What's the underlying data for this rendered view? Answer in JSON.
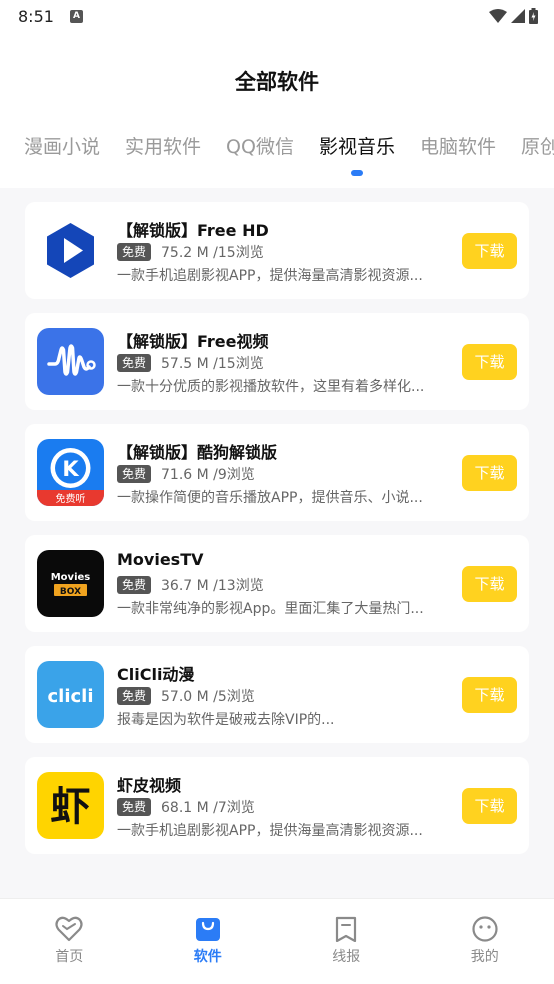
{
  "status_bar": {
    "time": "8:51",
    "notification_letter": "A"
  },
  "header": {
    "title": "全部软件"
  },
  "tabs": [
    {
      "label": "漫画小说"
    },
    {
      "label": "实用软件"
    },
    {
      "label": "QQ微信"
    },
    {
      "label": "影视音乐",
      "active": true
    },
    {
      "label": "电脑软件"
    },
    {
      "label": "原创"
    }
  ],
  "apps": [
    {
      "name": "【解锁版】Free HD",
      "badge": "免费",
      "meta": "75.2 M /15浏览",
      "desc": "一款手机追剧影视APP，提供海量高清影视资源...",
      "button": "下载",
      "icon": "play-triangle-icon"
    },
    {
      "name": "【解锁版】Free视频",
      "badge": "免费",
      "meta": "57.5 M /15浏览",
      "desc": "一款十分优质的影视播放软件，这里有着多样化...",
      "button": "下载",
      "icon": "waveform-icon"
    },
    {
      "name": "【解锁版】酷狗解锁版",
      "badge": "免费",
      "meta": "71.6 M /9浏览",
      "desc": "一款操作简便的音乐播放APP，提供音乐、小说...",
      "button": "下载",
      "icon": "kugou-icon",
      "icon_text": "免费听",
      "icon_letter": "K"
    },
    {
      "name": "MoviesTV",
      "badge": "免费",
      "meta": "36.7 M /13浏览",
      "desc": "一款非常纯净的影视App。里面汇集了大量热门...",
      "button": "下载",
      "icon": "movies-box-icon",
      "icon_text_top": "Movies",
      "icon_text_bottom": "BOX"
    },
    {
      "name": "CliCli动漫",
      "badge": "免费",
      "meta": "57.0 M /5浏览",
      "desc": "报毒是因为软件是破戒去除VIP的...",
      "button": "下载",
      "icon": "clicli-icon",
      "icon_text": "clicli"
    },
    {
      "name": "虾皮视频",
      "badge": "免费",
      "meta": "68.1 M /7浏览",
      "desc": "一款手机追剧影视APP，提供海量高清影视资源...",
      "button": "下载",
      "icon": "shrimp-icon",
      "icon_text": "虾"
    }
  ],
  "bottom_nav": [
    {
      "label": "首页",
      "icon": "heart-icon"
    },
    {
      "label": "软件",
      "icon": "bag-icon",
      "active": true
    },
    {
      "label": "线报",
      "icon": "bookmark-icon"
    },
    {
      "label": "我的",
      "icon": "face-icon"
    }
  ],
  "colors": {
    "accent": "#2b7cf6",
    "download": "#ffd21f",
    "badge": "#555555"
  }
}
